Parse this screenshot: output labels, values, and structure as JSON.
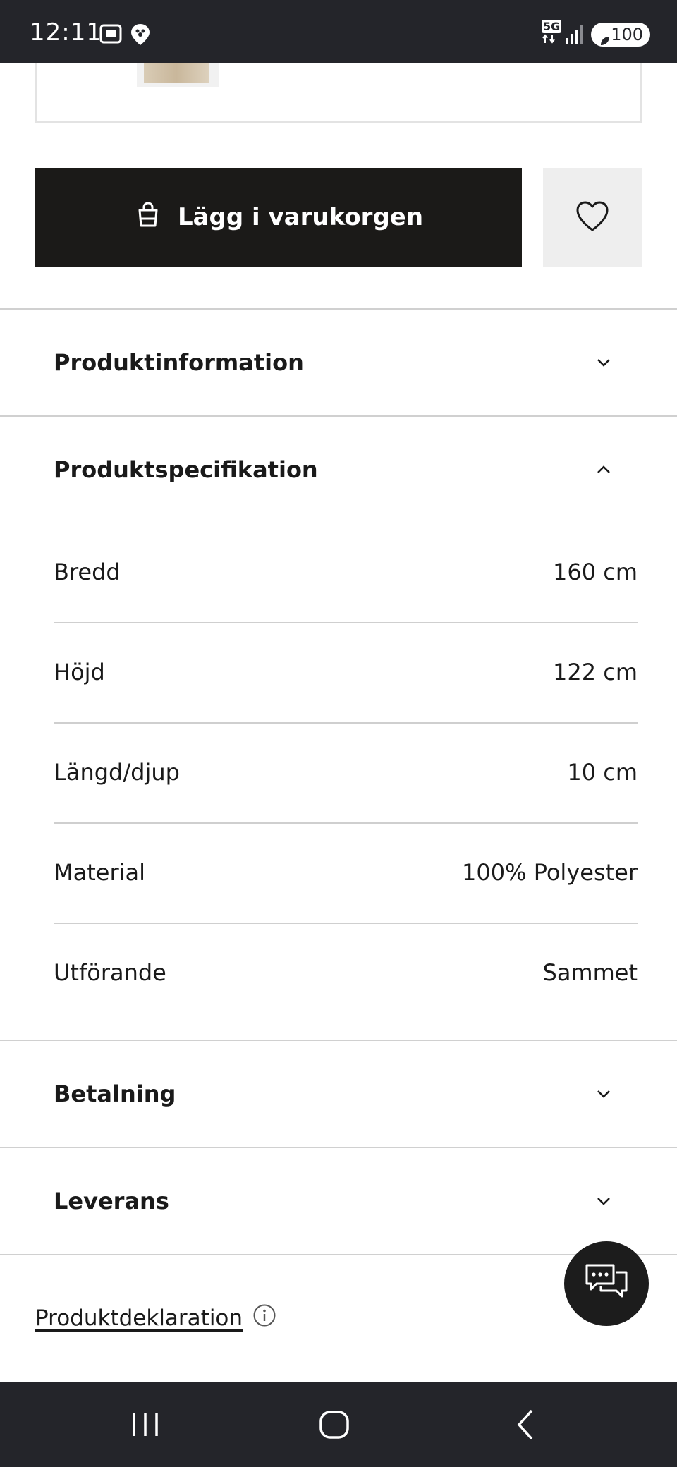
{
  "status_bar": {
    "time": "12:11",
    "network": "5G",
    "battery": "100"
  },
  "actions": {
    "add_to_cart_label": "Lägg i varukorgen",
    "wishlist_icon": "heart-icon",
    "cart_icon": "shopping-bag-icon"
  },
  "sections": {
    "product_info": {
      "title": "Produktinformation",
      "expanded": false
    },
    "product_spec": {
      "title": "Produktspecifikation",
      "expanded": true
    },
    "payment": {
      "title": "Betalning",
      "expanded": false
    },
    "delivery": {
      "title": "Leverans",
      "expanded": false
    }
  },
  "specs": [
    {
      "label": "Bredd",
      "value": "160 cm"
    },
    {
      "label": "Höjd",
      "value": "122 cm"
    },
    {
      "label": "Längd/djup",
      "value": "10 cm"
    },
    {
      "label": "Material",
      "value": "100% Polyester"
    },
    {
      "label": "Utförande",
      "value": "Sammet"
    }
  ],
  "declaration": {
    "link": "Produktdeklaration",
    "icon": "info-icon"
  },
  "chat": {
    "icon": "chat-icon"
  },
  "colors": {
    "primary_button": "#1b1a18",
    "wishlist_bg": "#eeeeee",
    "system_bar": "#24252a"
  }
}
